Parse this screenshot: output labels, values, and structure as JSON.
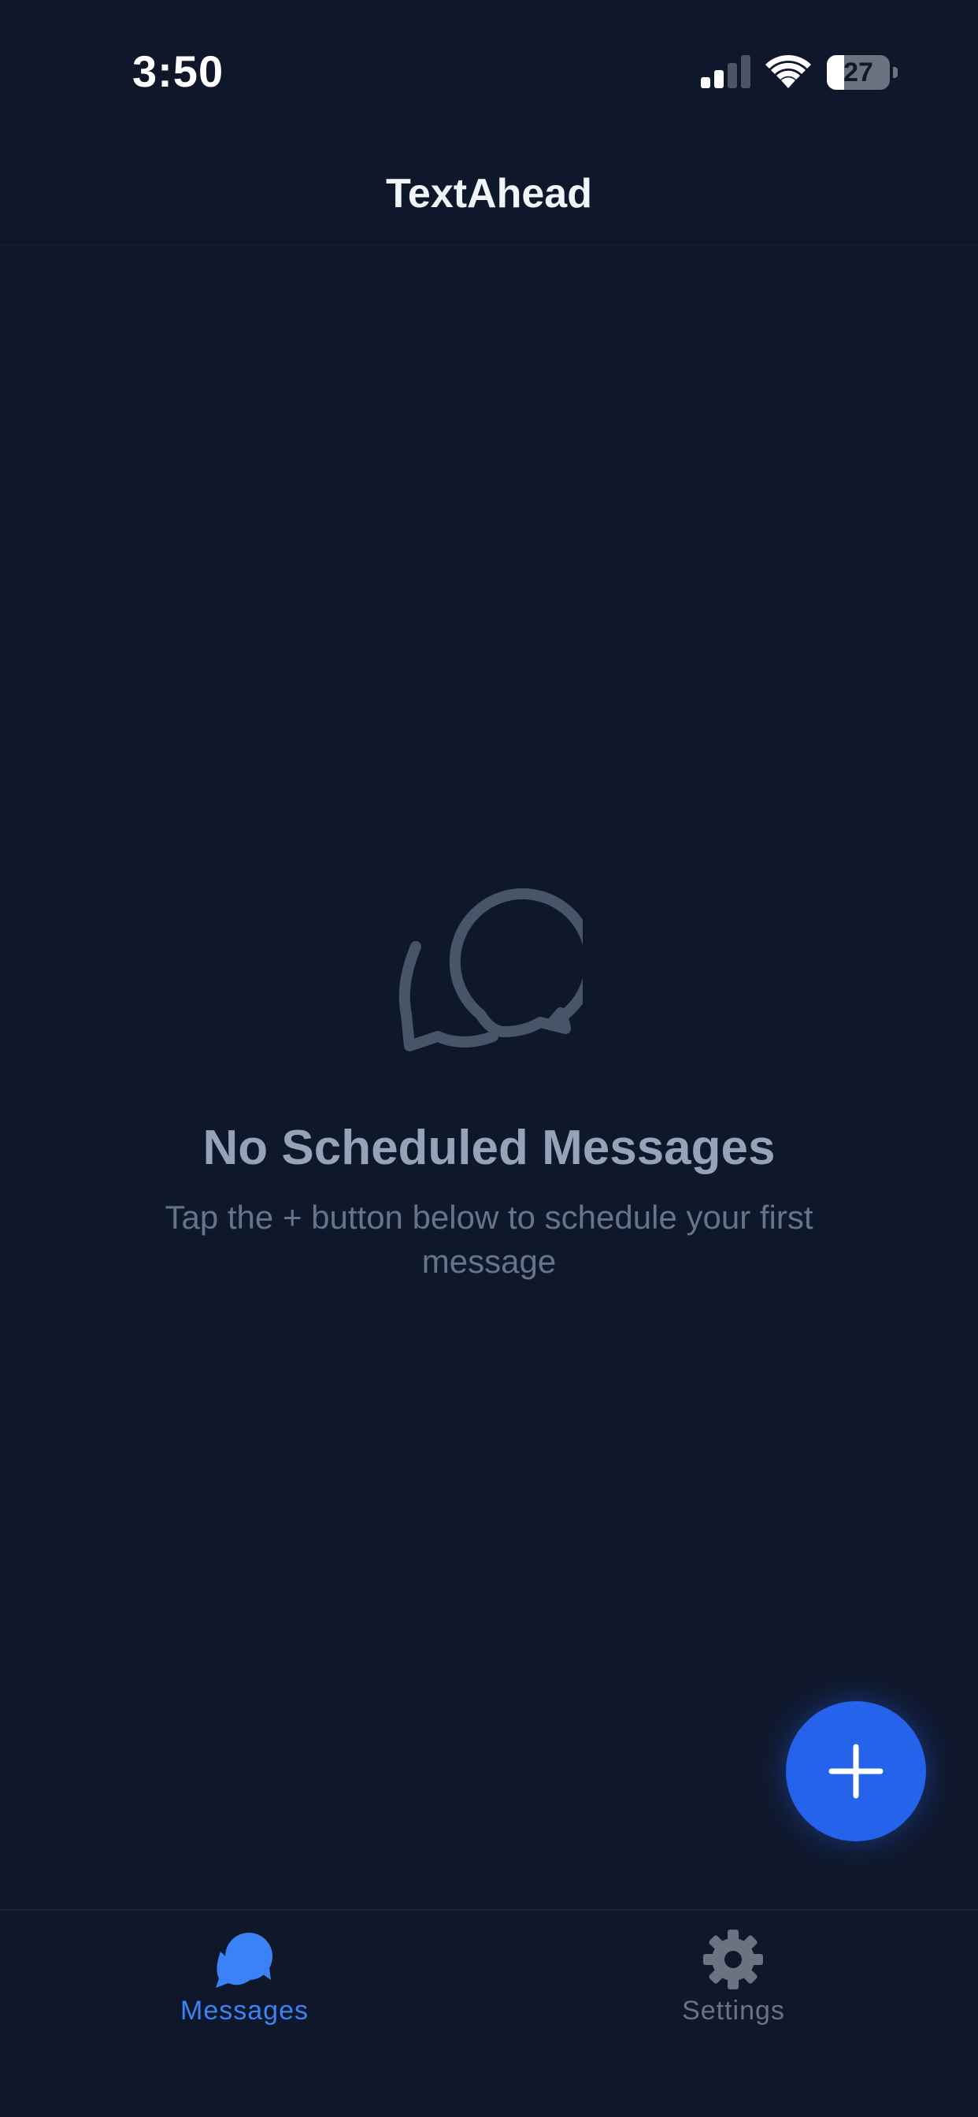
{
  "status_bar": {
    "time": "3:50",
    "battery_level": "27",
    "battery_fraction": 0.27,
    "signal_bars_active": 2,
    "signal_bars_total": 4
  },
  "header": {
    "title": "TextAhead"
  },
  "empty_state": {
    "icon": "chat-bubbles-icon",
    "title": "No Scheduled Messages",
    "subtitle": "Tap the + button below to schedule your first message"
  },
  "fab": {
    "icon": "plus-icon",
    "color": "#2563eb"
  },
  "tab_bar": {
    "tabs": [
      {
        "label": "Messages",
        "icon": "chat-bubbles-icon",
        "active": true,
        "color": "#3b82f6"
      },
      {
        "label": "Settings",
        "icon": "gear-icon",
        "active": false,
        "color": "#6b7280"
      }
    ]
  },
  "colors": {
    "background": "#0f172a",
    "accent": "#2563eb",
    "muted_text": "#64748b",
    "title_text": "#94a3b8"
  }
}
